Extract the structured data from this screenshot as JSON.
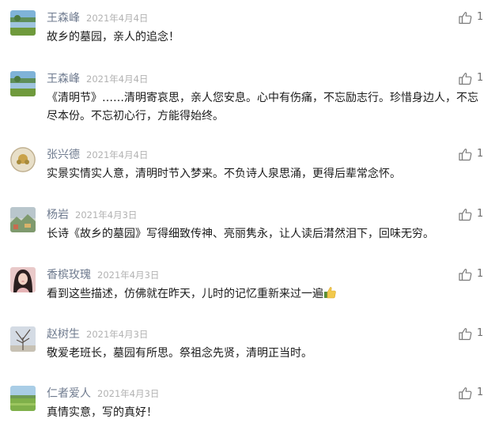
{
  "comments": [
    {
      "name": "王森峰",
      "date": "2021年4月4日",
      "text": "故乡的墓园，亲人的追念！",
      "likes": "1",
      "avatar": "landscape-lake"
    },
    {
      "name": "王森峰",
      "date": "2021年4月4日",
      "text": "《清明节》……清明寄哀思，亲人您安息。心中有伤痛，不忘励志行。珍惜身边人，不忘尽本份。不忘初心行，方能得始终。",
      "likes": "1",
      "avatar": "landscape-lake"
    },
    {
      "name": "张兴德",
      "date": "2021年4月4日",
      "text": "实景实情实人意，清明时节入梦来。不负诗人泉思涌，更得后辈常念怀。",
      "likes": "1",
      "avatar": "flower-circle"
    },
    {
      "name": "杨岩",
      "date": "2021年4月3日",
      "text": "长诗《故乡的墓园》写得细致传神、亮丽隽永，让人读后潸然泪下，回味无穷。",
      "likes": "1",
      "avatar": "painting"
    },
    {
      "name": "香槟玫瑰",
      "date": "2021年4月3日",
      "text": "看到这些描述，仿佛就在昨天，儿时的记忆重新来过一遍",
      "likes": "1",
      "avatar": "portrait"
    },
    {
      "name": "赵树生",
      "date": "2021年4月3日",
      "text": "敬爱老班长，墓园有所思。祭祖念先贤，清明正当时。",
      "likes": "1",
      "avatar": "bare-tree"
    },
    {
      "name": "仁者爱人",
      "date": "2021年4月3日",
      "text": "真情实意，写的真好！",
      "likes": "1",
      "avatar": "green-field"
    }
  ]
}
